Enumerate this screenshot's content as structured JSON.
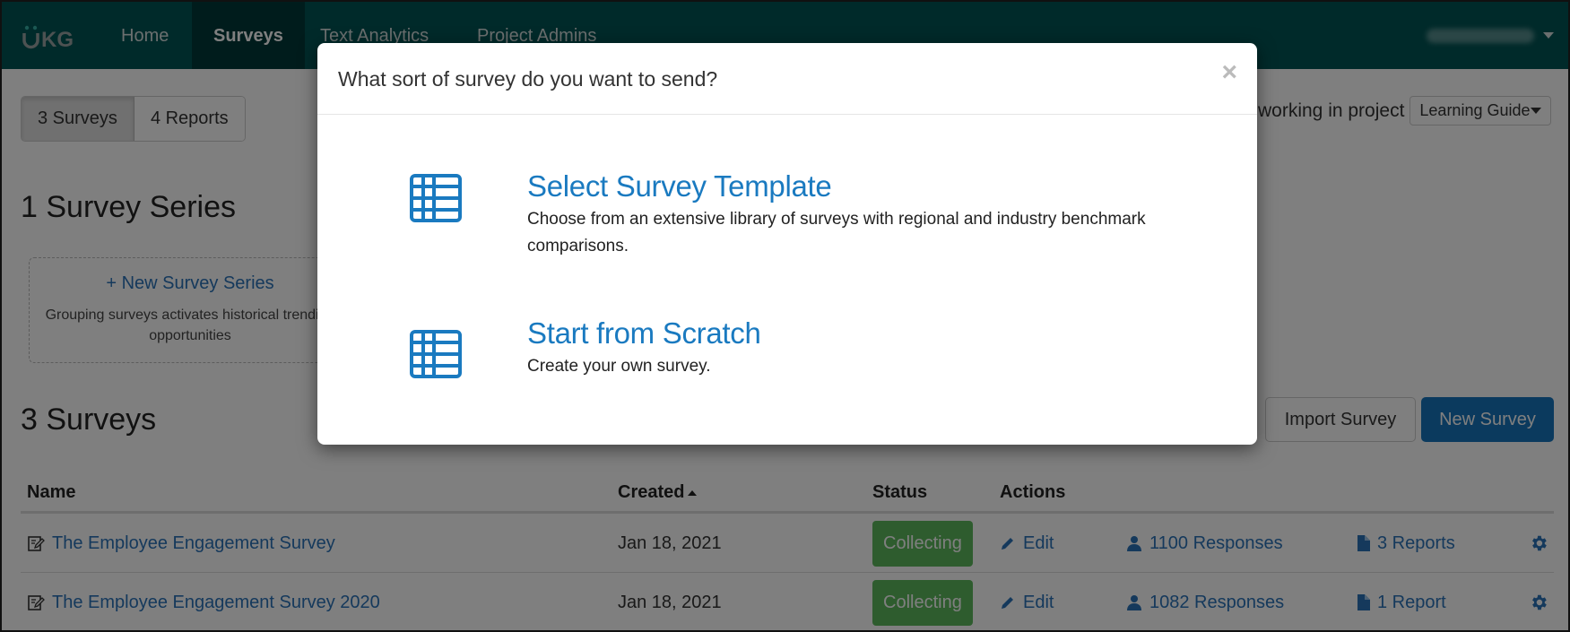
{
  "navbar": {
    "logo_text": "UKG",
    "items": [
      {
        "label": "Home",
        "active": false
      },
      {
        "label": "Surveys",
        "active": true
      },
      {
        "label": "Text Analytics",
        "active": false
      },
      {
        "label": "Project Admins",
        "active": false
      }
    ],
    "user_name": "(blurred)"
  },
  "toolbar": {
    "segments": [
      {
        "label": "3 Surveys",
        "active": true
      },
      {
        "label": "4 Reports",
        "active": false
      }
    ],
    "project_label": "working in project",
    "project_value": "Learning Guide"
  },
  "series": {
    "title": "1 Survey Series",
    "new_label": "+ New Survey Series",
    "description": "Grouping surveys activates historical trending opportunities"
  },
  "surveys": {
    "title": "3 Surveys",
    "import_label": "Import Survey",
    "new_label": "New Survey",
    "columns": {
      "name": "Name",
      "created": "Created",
      "status": "Status",
      "actions": "Actions"
    },
    "rows": [
      {
        "name": "The Employee Engagement Survey",
        "created": "Jan 18, 2021",
        "status": "Collecting",
        "edit": "Edit",
        "responses": "1100 Responses",
        "reports": "3 Reports"
      },
      {
        "name": "The Employee Engagement Survey 2020",
        "created": "Jan 18, 2021",
        "status": "Collecting",
        "edit": "Edit",
        "responses": "1082 Responses",
        "reports": "1 Report"
      }
    ]
  },
  "modal": {
    "title": "What sort of survey do you want to send?",
    "close_glyph": "×",
    "options": [
      {
        "icon": "table-grid-icon",
        "title": "Select Survey Template",
        "description": "Choose from an extensive library of surveys with regional and industry benchmark comparisons."
      },
      {
        "icon": "table-grid-icon",
        "title": "Start from Scratch",
        "description": "Create your own survey."
      }
    ]
  },
  "colors": {
    "navbar": "#005454",
    "link": "#2a72b8",
    "modal_link": "#1a7ac0",
    "status_collecting": "#5cb85c",
    "primary_button": "#1674bc"
  }
}
